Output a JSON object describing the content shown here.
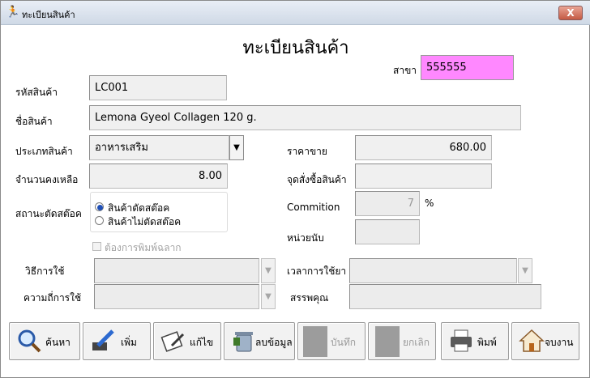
{
  "window": {
    "title": "ทะเบียนสินค้า",
    "close_glyph": "X"
  },
  "form": {
    "heading": "ทะเบียนสินค้า",
    "branch": {
      "label": "สาขา",
      "value": "555555"
    },
    "code": {
      "label": "รหัสสินค้า",
      "value": "LC001"
    },
    "name": {
      "label": "ชื่อสินค้า",
      "value": "Lemona Gyeol Collagen 120 g."
    },
    "category": {
      "label": "ประเภทสินค้า",
      "value": "อาหารเสริม"
    },
    "price": {
      "label": "ราคาขาย",
      "value": "680.00"
    },
    "stock": {
      "label": "จำนวนคงเหลือ",
      "value": "8.00"
    },
    "reorder": {
      "label": "จุดสั่งซื้อสินค้า",
      "value": ""
    },
    "stock_status": {
      "label": "สถานะตัดสต๊อค",
      "options": [
        "สินค้าตัดสต๊อค",
        "สินค้าไม่ตัดสต๊อค"
      ],
      "selected": "สินค้าตัดสต๊อค"
    },
    "commission": {
      "label": "Commition",
      "value": "7",
      "unit": "%"
    },
    "unit": {
      "label": "หน่วยนับ",
      "value": ""
    },
    "print_label": {
      "label": "ต้องการพิมพ์ฉลาก",
      "checked": false
    },
    "usage_method": {
      "label": "วิธีการใช้",
      "value": ""
    },
    "usage_time": {
      "label": "เวลาการใช้ยา",
      "value": ""
    },
    "frequency": {
      "label": "ความถี่การใช้",
      "value": ""
    },
    "properties": {
      "label": "สรรพคุณ",
      "value": ""
    }
  },
  "toolbar": {
    "search": "ค้นหา",
    "add": "เพิ่ม",
    "edit": "แก้ไข",
    "delete": "ลบข้อมูล",
    "save": "บันทึก",
    "cancel": "ยกเลิก",
    "print": "พิมพ์",
    "exit": "จบงาน"
  },
  "colors": {
    "branch_bg": "#ff88ff",
    "field_bg": "#f0f0f0"
  }
}
